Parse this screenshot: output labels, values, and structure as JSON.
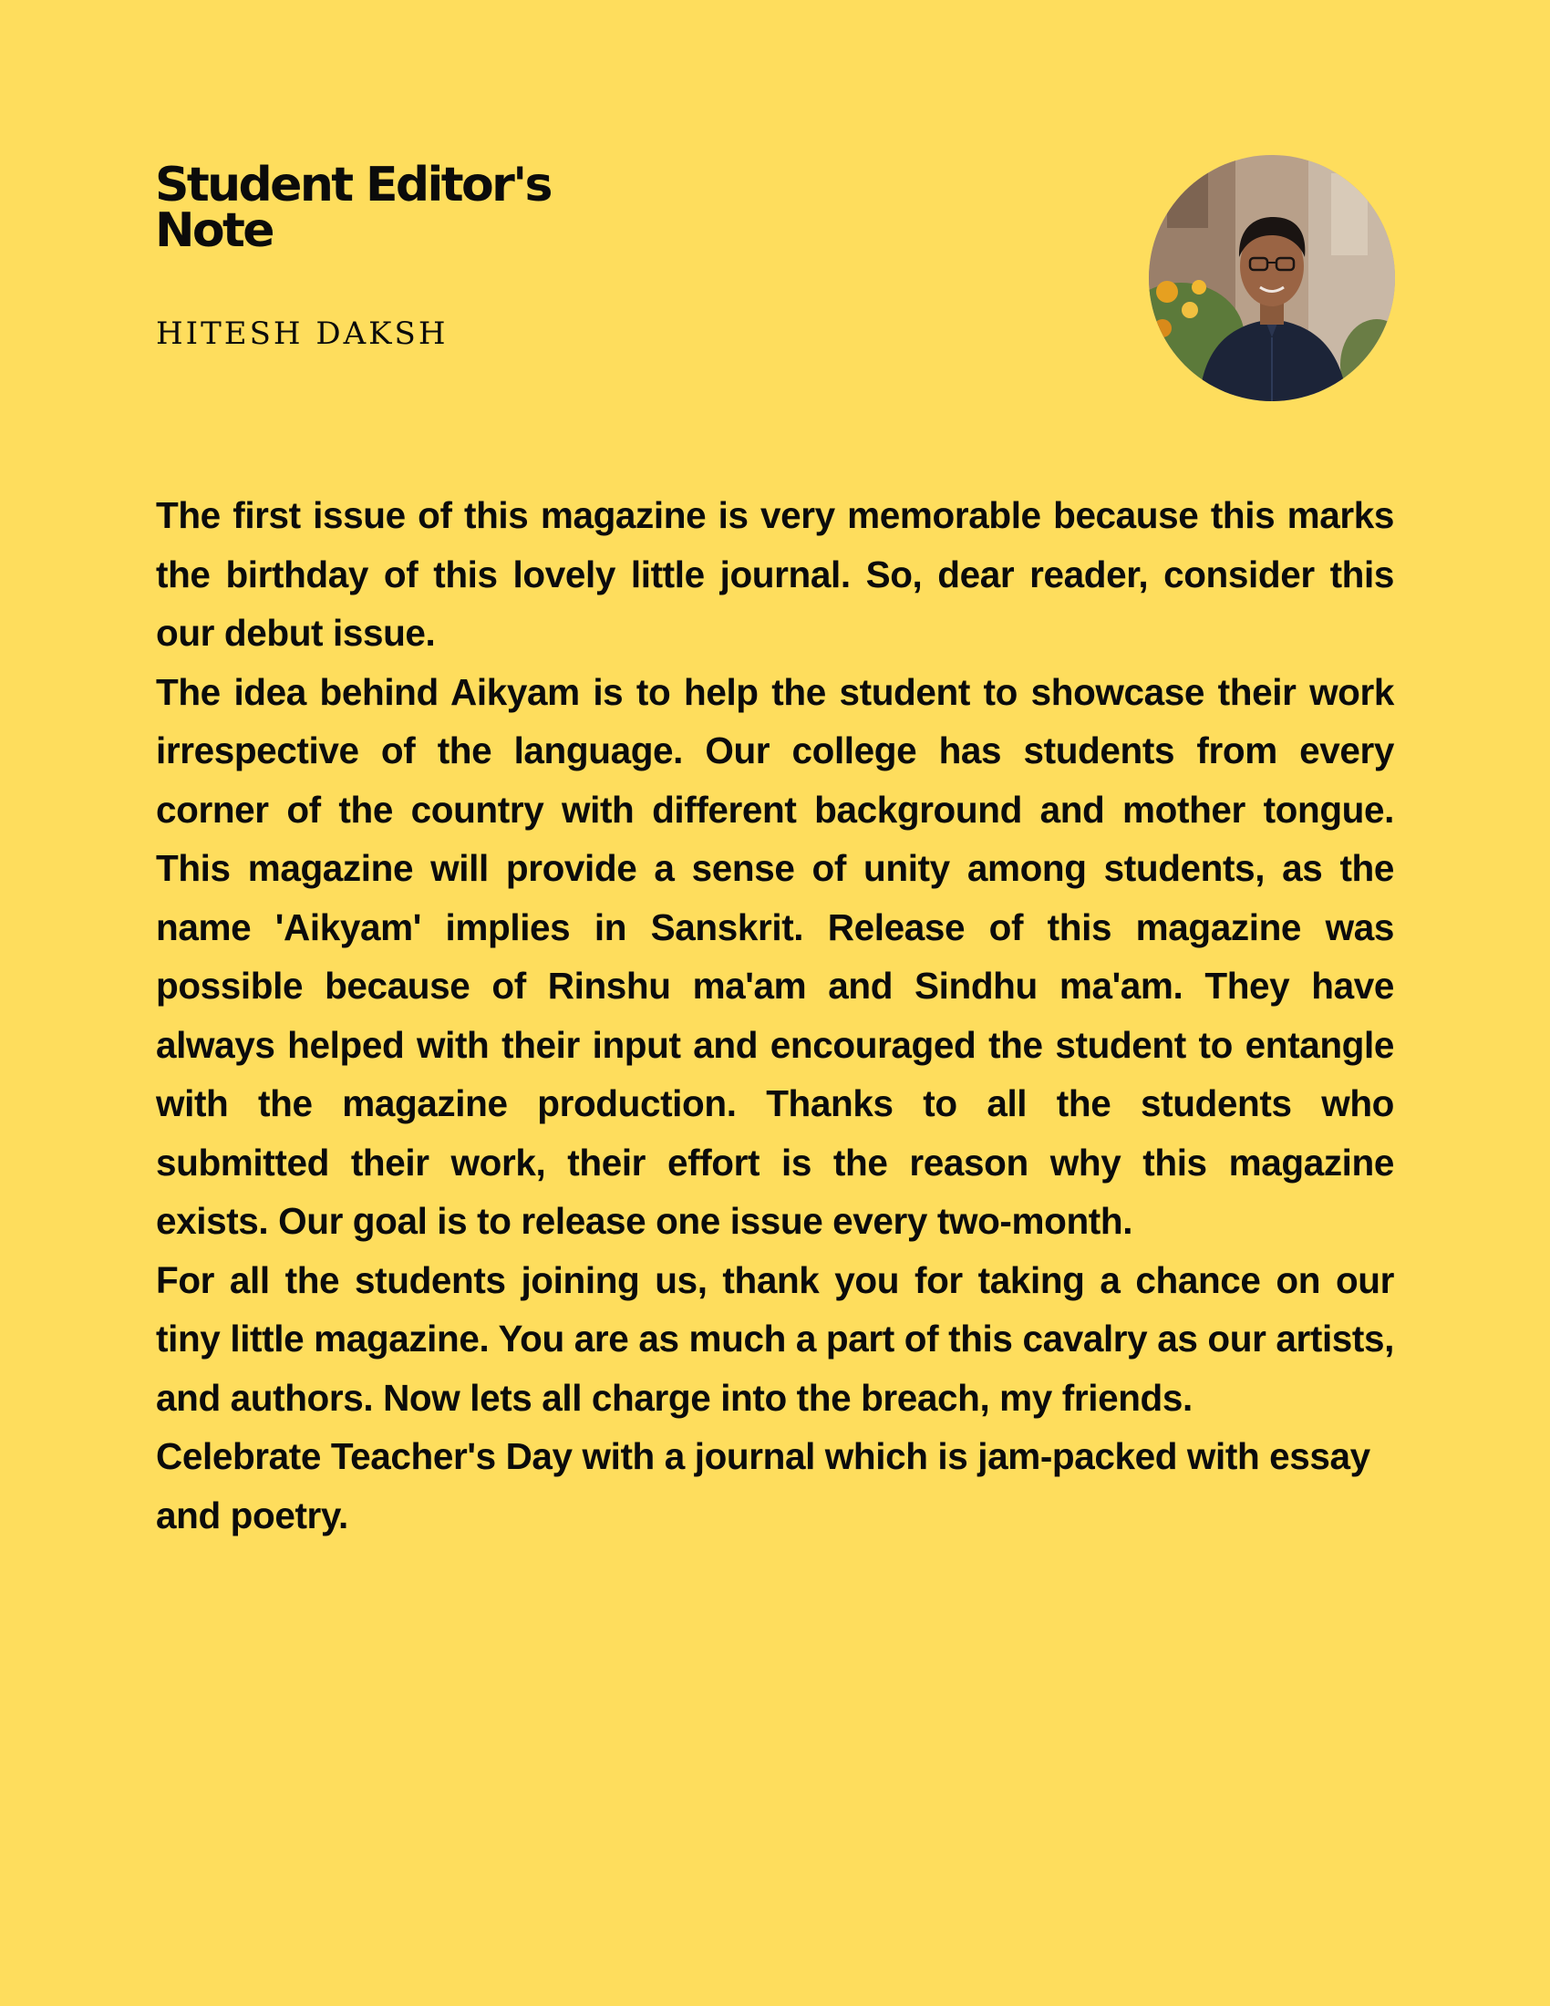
{
  "header": {
    "title": "Student Editor's\nNote",
    "author": "HITESH DAKSH"
  },
  "avatar": {
    "icon": "editor-portrait-photo"
  },
  "body": {
    "paragraphs": [
      "The first issue of this magazine is very memorable because this marks the birthday of this lovely little journal. So, dear reader, consider this our debut issue.",
      "The idea behind Aikyam is to help the student to showcase their work irrespective of the language. Our college has students from every corner of the country with different background and mother tongue. This magazine will provide a sense of unity among students, as the name 'Aikyam' implies in Sanskrit. Release of this magazine was possible because of Rinshu ma'am and Sindhu ma'am. They have always helped with their input and encouraged the student to entangle with the magazine production. Thanks to all the students who submitted their work, their effort is the reason why this magazine exists. Our goal is to release one issue every two-month.",
      "For all the students joining us, thank you for taking a chance on our tiny little magazine. You are as much a part of this cavalry as our artists, and authors. Now lets all charge into the breach, my friends.",
      "Celebrate Teacher's Day with a journal which is jam-packed with essay and poetry."
    ]
  },
  "colors": {
    "background": "#FEDD5D",
    "text": "#0B0B0B"
  }
}
